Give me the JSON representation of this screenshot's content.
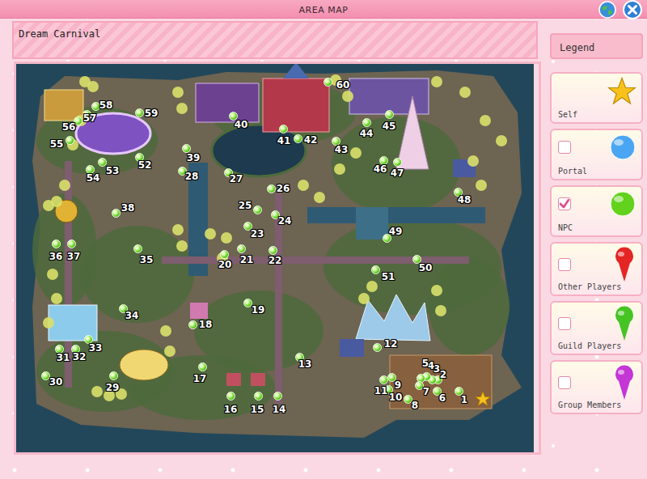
{
  "window": {
    "title": "AREA MAP"
  },
  "area": {
    "name": "Dream Carnival"
  },
  "legend": {
    "title": "Legend",
    "items": [
      {
        "label": "Self",
        "kind": "star",
        "color": "#f7c21c"
      },
      {
        "label": "Portal",
        "kind": "ball",
        "color": "#4aa6f2",
        "checked": false
      },
      {
        "label": "NPC",
        "kind": "ball",
        "color": "#62d21c",
        "checked": true
      },
      {
        "label": "Other Players",
        "kind": "pin",
        "color": "#e52424",
        "checked": false
      },
      {
        "label": "Guild Players",
        "kind": "pin",
        "color": "#46c424",
        "checked": false
      },
      {
        "label": "Group Members",
        "kind": "pin",
        "color": "#c436d6",
        "checked": false
      }
    ]
  },
  "map": {
    "npcs": [
      {
        "label": "1"
      },
      {
        "label": "2"
      },
      {
        "label": "3"
      },
      {
        "label": "4"
      },
      {
        "label": "5"
      },
      {
        "label": "6"
      },
      {
        "label": "7"
      },
      {
        "label": "8"
      },
      {
        "label": "9"
      },
      {
        "label": "10"
      },
      {
        "label": "11"
      },
      {
        "label": "12"
      },
      {
        "label": "13"
      },
      {
        "label": "14"
      },
      {
        "label": "15"
      },
      {
        "label": "16"
      },
      {
        "label": "17"
      },
      {
        "label": "18"
      },
      {
        "label": "19"
      },
      {
        "label": "20"
      },
      {
        "label": "21"
      },
      {
        "label": "22"
      },
      {
        "label": "23"
      },
      {
        "label": "24"
      },
      {
        "label": "25"
      },
      {
        "label": "26"
      },
      {
        "label": "27"
      },
      {
        "label": "28"
      },
      {
        "label": "29"
      },
      {
        "label": "30"
      },
      {
        "label": "31"
      },
      {
        "label": "32"
      },
      {
        "label": "33"
      },
      {
        "label": "34"
      },
      {
        "label": "35"
      },
      {
        "label": "36"
      },
      {
        "label": "37"
      },
      {
        "label": "38"
      },
      {
        "label": "39"
      },
      {
        "label": "40"
      },
      {
        "label": "41"
      },
      {
        "label": "42"
      },
      {
        "label": "43"
      },
      {
        "label": "44"
      },
      {
        "label": "45"
      },
      {
        "label": "46"
      },
      {
        "label": "47"
      },
      {
        "label": "48"
      },
      {
        "label": "49"
      },
      {
        "label": "50"
      },
      {
        "label": "51"
      },
      {
        "label": "52"
      },
      {
        "label": "53"
      },
      {
        "label": "54"
      },
      {
        "label": "55"
      },
      {
        "label": "56"
      },
      {
        "label": "57"
      },
      {
        "label": "58"
      },
      {
        "label": "59"
      },
      {
        "label": "60"
      }
    ]
  }
}
